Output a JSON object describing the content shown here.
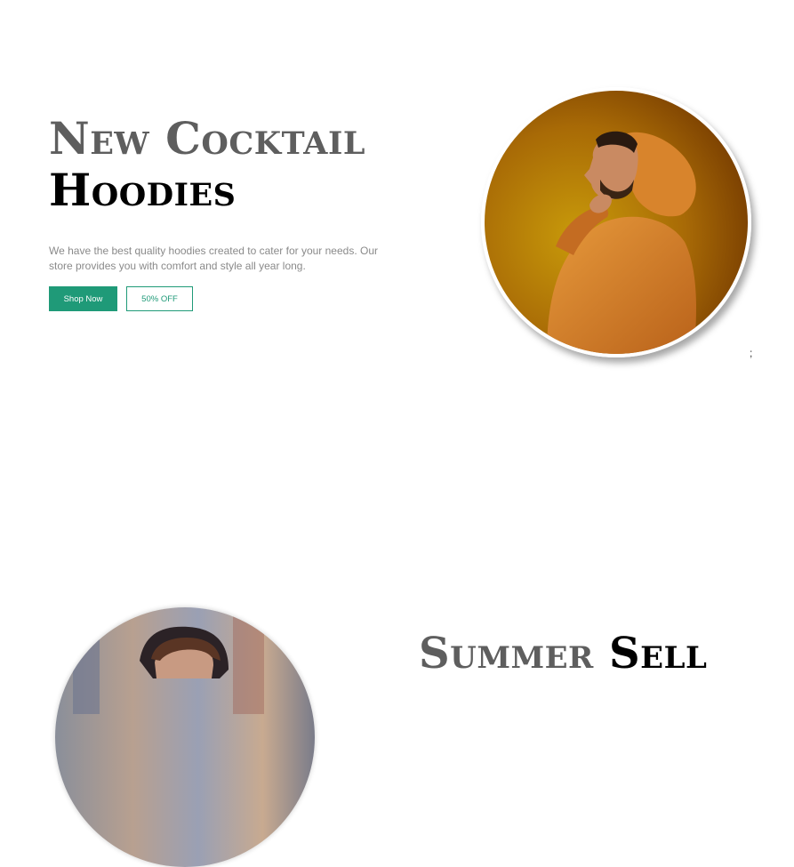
{
  "hero": {
    "title_line1": "New Cocktail",
    "title_line2": "Hoodies",
    "description": "We have the best quality hoodies created to cater for your needs. Our store provides you with comfort and style all year long.",
    "shop_button": "Shop Now",
    "discount_button": "50% OFF"
  },
  "stray_char": ";",
  "second_section": {
    "title_part1": "Summer",
    "title_part2": "Sell"
  },
  "colors": {
    "accent": "#1f9a78",
    "title_gray": "#5e5e5e",
    "body_text": "#8a8a8a"
  }
}
